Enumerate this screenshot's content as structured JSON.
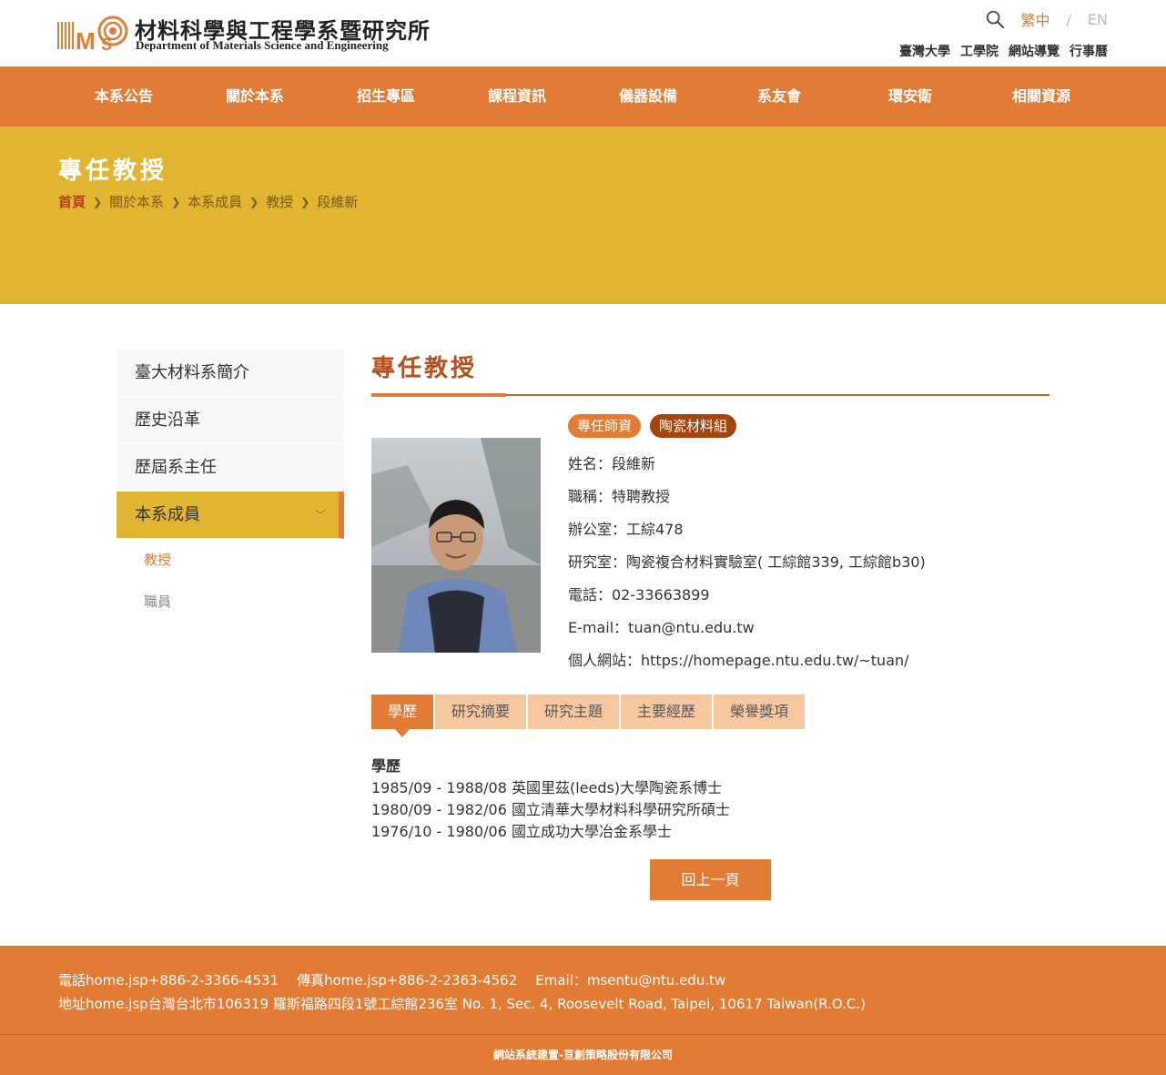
{
  "header": {
    "logo_cn": "材料科學與工程學系暨研究所",
    "logo_en": "Department of Materials Science and Engineering",
    "lang_zh": "繁中",
    "lang_sep": "/",
    "lang_en": "EN",
    "util_links": [
      "臺灣大學",
      "工學院",
      "網站導覽",
      "行事曆"
    ]
  },
  "nav": [
    "本系公告",
    "關於本系",
    "招生專區",
    "課程資訊",
    "儀器設備",
    "系友會",
    "環安衛",
    "相關資源"
  ],
  "banner": {
    "title": "專任教授",
    "breadcrumbs": [
      "首頁",
      "關於本系",
      "本系成員",
      "教授",
      "段維新"
    ]
  },
  "sidebar": {
    "items": [
      "臺大材料系簡介",
      "歷史沿革",
      "歷屆系主任",
      "本系成員"
    ],
    "subitems": [
      "教授",
      "職員"
    ]
  },
  "main": {
    "title": "專任教授",
    "tags": [
      "專任師資",
      "陶瓷材料組"
    ],
    "info": [
      "姓名：段維新",
      "職稱：特聘教授",
      "辦公室：工綜478",
      "研究室：陶瓷複合材料實驗室( 工綜館339, 工綜館b30)",
      "電話：02-33663899",
      "E-mail：tuan@ntu.edu.tw",
      "個人網站：https://homepage.ntu.edu.tw/~tuan/"
    ],
    "tabs": [
      "學歷",
      "研究摘要",
      "研究主題",
      "主要經歷",
      "榮譽獎項"
    ],
    "education_heading": "學歷",
    "education": [
      "1985/09 - 1988/08 英國里茲(leeds)大學陶瓷系博士",
      "1980/09 - 1982/06 國立清華大學材料科學研究所碩士",
      "1976/10 - 1980/06 國立成功大學冶金系學士"
    ],
    "back_label": "回上一頁"
  },
  "footer": {
    "phone": "電話home.jsp+886-2-3366-4531",
    "fax": "傳真home.jsp+886-2-2363-4562",
    "email": "Email：msentu@ntu.edu.tw",
    "address": "地址home.jsp台灣台北市106319 羅斯福路四段1號工綜館236室 No. 1, Sec. 4, Roosevelt Road, Taipei, 10617 Taiwan(R.O.C.)",
    "copyright": "網站系統建置-亘創策略股份有限公司"
  },
  "colors": {
    "accent_orange": "#e27b34",
    "banner_yellow": "#e1b532",
    "title_brown": "#b5501c"
  }
}
